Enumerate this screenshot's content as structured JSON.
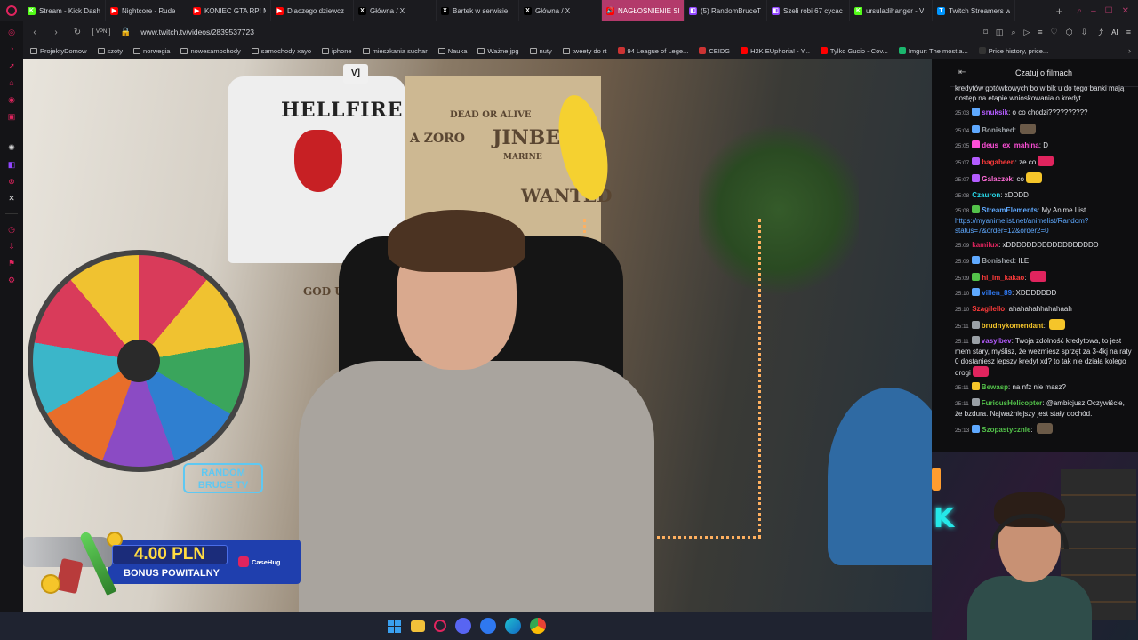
{
  "browser": {
    "tabs": [
      {
        "label": "Stream - Kick Dash",
        "fav_color": "#53fc18",
        "fav_glyph": "K"
      },
      {
        "label": "Nightcore - Rude",
        "fav_color": "#ff0000",
        "fav_glyph": "▶"
      },
      {
        "label": "KONIEC GTA RP! M",
        "fav_color": "#ff0000",
        "fav_glyph": "▶"
      },
      {
        "label": "Dlaczego dziewcz",
        "fav_color": "#ff0000",
        "fav_glyph": "▶"
      },
      {
        "label": "Główna / X",
        "fav_color": "#000000",
        "fav_glyph": "X"
      },
      {
        "label": "Bartek w serwisie",
        "fav_color": "#000000",
        "fav_glyph": "X"
      },
      {
        "label": "Główna / X",
        "fav_color": "#000000",
        "fav_glyph": "X"
      },
      {
        "label": "NAGŁOŚNIENIE SPRAW",
        "fav_color": "#ff0000",
        "fav_glyph": "🔊",
        "active": true
      },
      {
        "label": "(5) RandomBruceT",
        "fav_color": "#9146ff",
        "fav_glyph": "◧"
      },
      {
        "label": "Szeli robi 67 cycac",
        "fav_color": "#9146ff",
        "fav_glyph": "◧"
      },
      {
        "label": "ursuladihanger - V",
        "fav_color": "#53fc18",
        "fav_glyph": "K"
      },
      {
        "label": "Twitch Streamers w",
        "fav_color": "#0096ff",
        "fav_glyph": "T"
      }
    ],
    "new_tab": "+",
    "url": "www.twitch.tv/videos/2839537723",
    "vpn": "VPN",
    "ai_label": "AI",
    "bookmarks": [
      {
        "label": "ProjektyDomow",
        "type": "folder"
      },
      {
        "label": "szoty",
        "type": "folder"
      },
      {
        "label": "norwegia",
        "type": "folder"
      },
      {
        "label": "nowesamochody",
        "type": "folder"
      },
      {
        "label": "samochody xayo",
        "type": "folder"
      },
      {
        "label": "iphone",
        "type": "folder"
      },
      {
        "label": "mieszkania suchar",
        "type": "folder"
      },
      {
        "label": "Nauka",
        "type": "folder"
      },
      {
        "label": "Ważne jpg",
        "type": "folder"
      },
      {
        "label": "nuty",
        "type": "folder"
      },
      {
        "label": "tweety do rt",
        "type": "folder"
      },
      {
        "label": "94 League of Lege...",
        "type": "site",
        "color": "#c33"
      },
      {
        "label": "CEIDG",
        "type": "site",
        "color": "#c33"
      },
      {
        "label": "H2K EUphoria! - Y...",
        "type": "site",
        "color": "#ff0000"
      },
      {
        "label": "Tylko Gucio - Cov...",
        "type": "site",
        "color": "#ff0000"
      },
      {
        "label": "Imgur: The most a...",
        "type": "site",
        "color": "#1bb76e"
      },
      {
        "label": "Price history, price...",
        "type": "site",
        "color": "#333"
      }
    ]
  },
  "video": {
    "shirt_text": "HELLFIRE CLUB",
    "poster_1": "DEAD OR ALIVE",
    "poster_2": "JINBE",
    "poster_3": "MARINE",
    "poster_4": "WANTED",
    "poster_5": "A ZORO",
    "poster_6": "GOD USO",
    "neon_sign": "RANDOM BRUCE TV",
    "corner_icon": "V]"
  },
  "bonus": {
    "amount": "4.00 PLN",
    "label": "BONUS POWITALNY",
    "brand": "CaseHug"
  },
  "chat": {
    "title": "Czatuj o filmach",
    "top_fragment": "kredytów gotówkowych bo w bik u do tego banki mają dostęp na etapie wnioskowania o kredyt",
    "messages": [
      {
        "time": "25:03",
        "user": "snuksik",
        "color": "#b45cff",
        "text": "o co chodzi??????????",
        "badge": "#5fa9ff"
      },
      {
        "time": "25:04",
        "user": "Bonished",
        "color": "#9aa0a6",
        "text": "",
        "badge": "#5fa9ff",
        "emote": "#6b5a48"
      },
      {
        "time": "25:05",
        "user": "deus_ex_mahina",
        "color": "#ff4fd8",
        "text": "D",
        "badge": "#ff4fd8"
      },
      {
        "time": "25:07",
        "user": "bagabeen",
        "color": "#ff3b3b",
        "text": "ze co",
        "badge": "#b45cff",
        "emote": "#e0245e"
      },
      {
        "time": "25:07",
        "user": "Galaczek",
        "color": "#ff6bd6",
        "text": "co",
        "badge": "#b45cff",
        "emote": "#f5c52a"
      },
      {
        "time": "25:08",
        "user": "Czauron",
        "color": "#28d7e8",
        "text": "xDDDD",
        "badge": ""
      },
      {
        "time": "25:08",
        "user": "StreamElements",
        "color": "#5fa9ff",
        "text": "My Anime List",
        "badge": "#53c24a",
        "link": "https://myanimelist.net/animelist/Random?status=7&order=12&order2=0"
      },
      {
        "time": "25:09",
        "user": "kamilux",
        "color": "#e0245e",
        "text": "xDDDDDDDDDDDDDDDDDD",
        "badge": ""
      },
      {
        "time": "25:09",
        "user": "Bonished",
        "color": "#9aa0a6",
        "text": "ILE",
        "badge": "#5fa9ff"
      },
      {
        "time": "25:09",
        "user": "hi_im_kakao",
        "color": "#ff3b3b",
        "text": "",
        "badge": "#53c24a",
        "emote": "#e0245e"
      },
      {
        "time": "25:10",
        "user": "villen_89",
        "color": "#2f78f0",
        "text": "XDDDDDDD",
        "badge": "#5fa9ff"
      },
      {
        "time": "25:10",
        "user": "Szagilello",
        "color": "#ff3b3b",
        "text": "ahahahahhahahaah",
        "badge": ""
      },
      {
        "time": "25:11",
        "user": "brudnykomendant",
        "color": "#f5c52a",
        "text": "",
        "badge": "#9aa0a6",
        "emote": "#f5c52a"
      },
      {
        "time": "25:11",
        "user": "vasylbev",
        "color": "#b45cff",
        "text": "Twoja zdolność kredytowa, to jest mem stary, myślisz, że wezmiesz sprzęt za 3-4kj na raty 0 dostaniesz lepszy kredyt xd? to tak nie działa kolego drogi",
        "badge": "#9aa0a6",
        "emote": "#e0245e"
      },
      {
        "time": "25:11",
        "user": "Bewasp",
        "color": "#53c24a",
        "text": "na nfz nie masz?",
        "badge": "#f5c52a"
      },
      {
        "time": "25:11",
        "user": "FuriousHelicopter",
        "color": "#53c24a",
        "text": "@ambicjusz Oczywiście, że bzdura. Najważniejszy jest stały dochód.",
        "badge": "#9aa0a6"
      },
      {
        "time": "25:13",
        "user": "Szopastycznie",
        "color": "#53c24a",
        "text": "",
        "badge": "#5fa9ff",
        "emote": "#6b5a48"
      }
    ]
  }
}
